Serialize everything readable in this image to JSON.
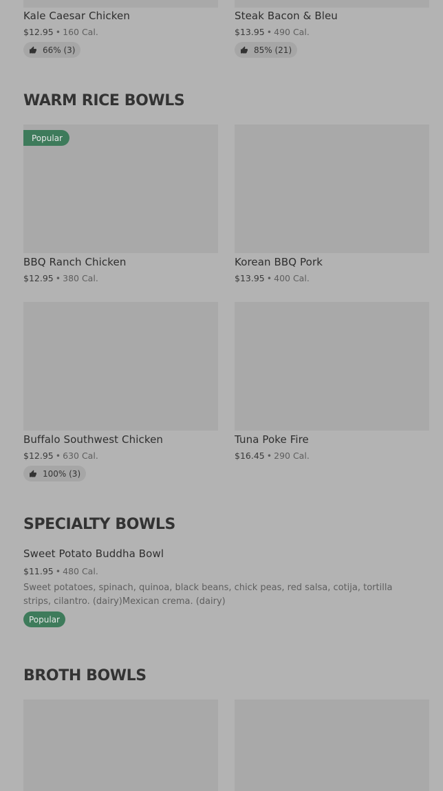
{
  "top_row": [
    {
      "name": "Kale Caesar Chicken",
      "price": "$12.95",
      "cal": "160 Cal.",
      "rating": "66% (3)"
    },
    {
      "name": "Steak Bacon & Bleu",
      "price": "$13.95",
      "cal": "490 Cal.",
      "rating": "85% (21)"
    }
  ],
  "warm_rice": {
    "title": "WARM RICE BOWLS",
    "items": [
      {
        "name": "BBQ Ranch Chicken",
        "price": "$12.95",
        "cal": "380 Cal.",
        "badge": "Popular"
      },
      {
        "name": "Korean BBQ Pork",
        "price": "$13.95",
        "cal": "400 Cal."
      },
      {
        "name": "Buffalo Southwest Chicken",
        "price": "$12.95",
        "cal": "630 Cal.",
        "rating": "100% (3)"
      },
      {
        "name": "Tuna Poke Fire",
        "price": "$16.45",
        "cal": "290 Cal."
      }
    ]
  },
  "specialty": {
    "title": "SPECIALTY BOWLS",
    "item": {
      "name": "Sweet Potato Buddha Bowl",
      "price": "$11.95",
      "cal": "480 Cal.",
      "description": "Sweet potatoes, spinach, quinoa, black beans, chick peas, red salsa, cotija, tortilla strips, cilantro. (dairy)Mexican crema. (dairy)",
      "badge": "Popular"
    }
  },
  "broth": {
    "title": "BROTH BOWLS"
  },
  "meta_separator": "•",
  "colors": {
    "background": "#b3b3b3",
    "image_placeholder": "#a9a9a9",
    "badge_green": "#3e7b5b",
    "rating_pill": "#a6a6a6"
  },
  "icons": {
    "rating": "thumbs-up-icon"
  }
}
